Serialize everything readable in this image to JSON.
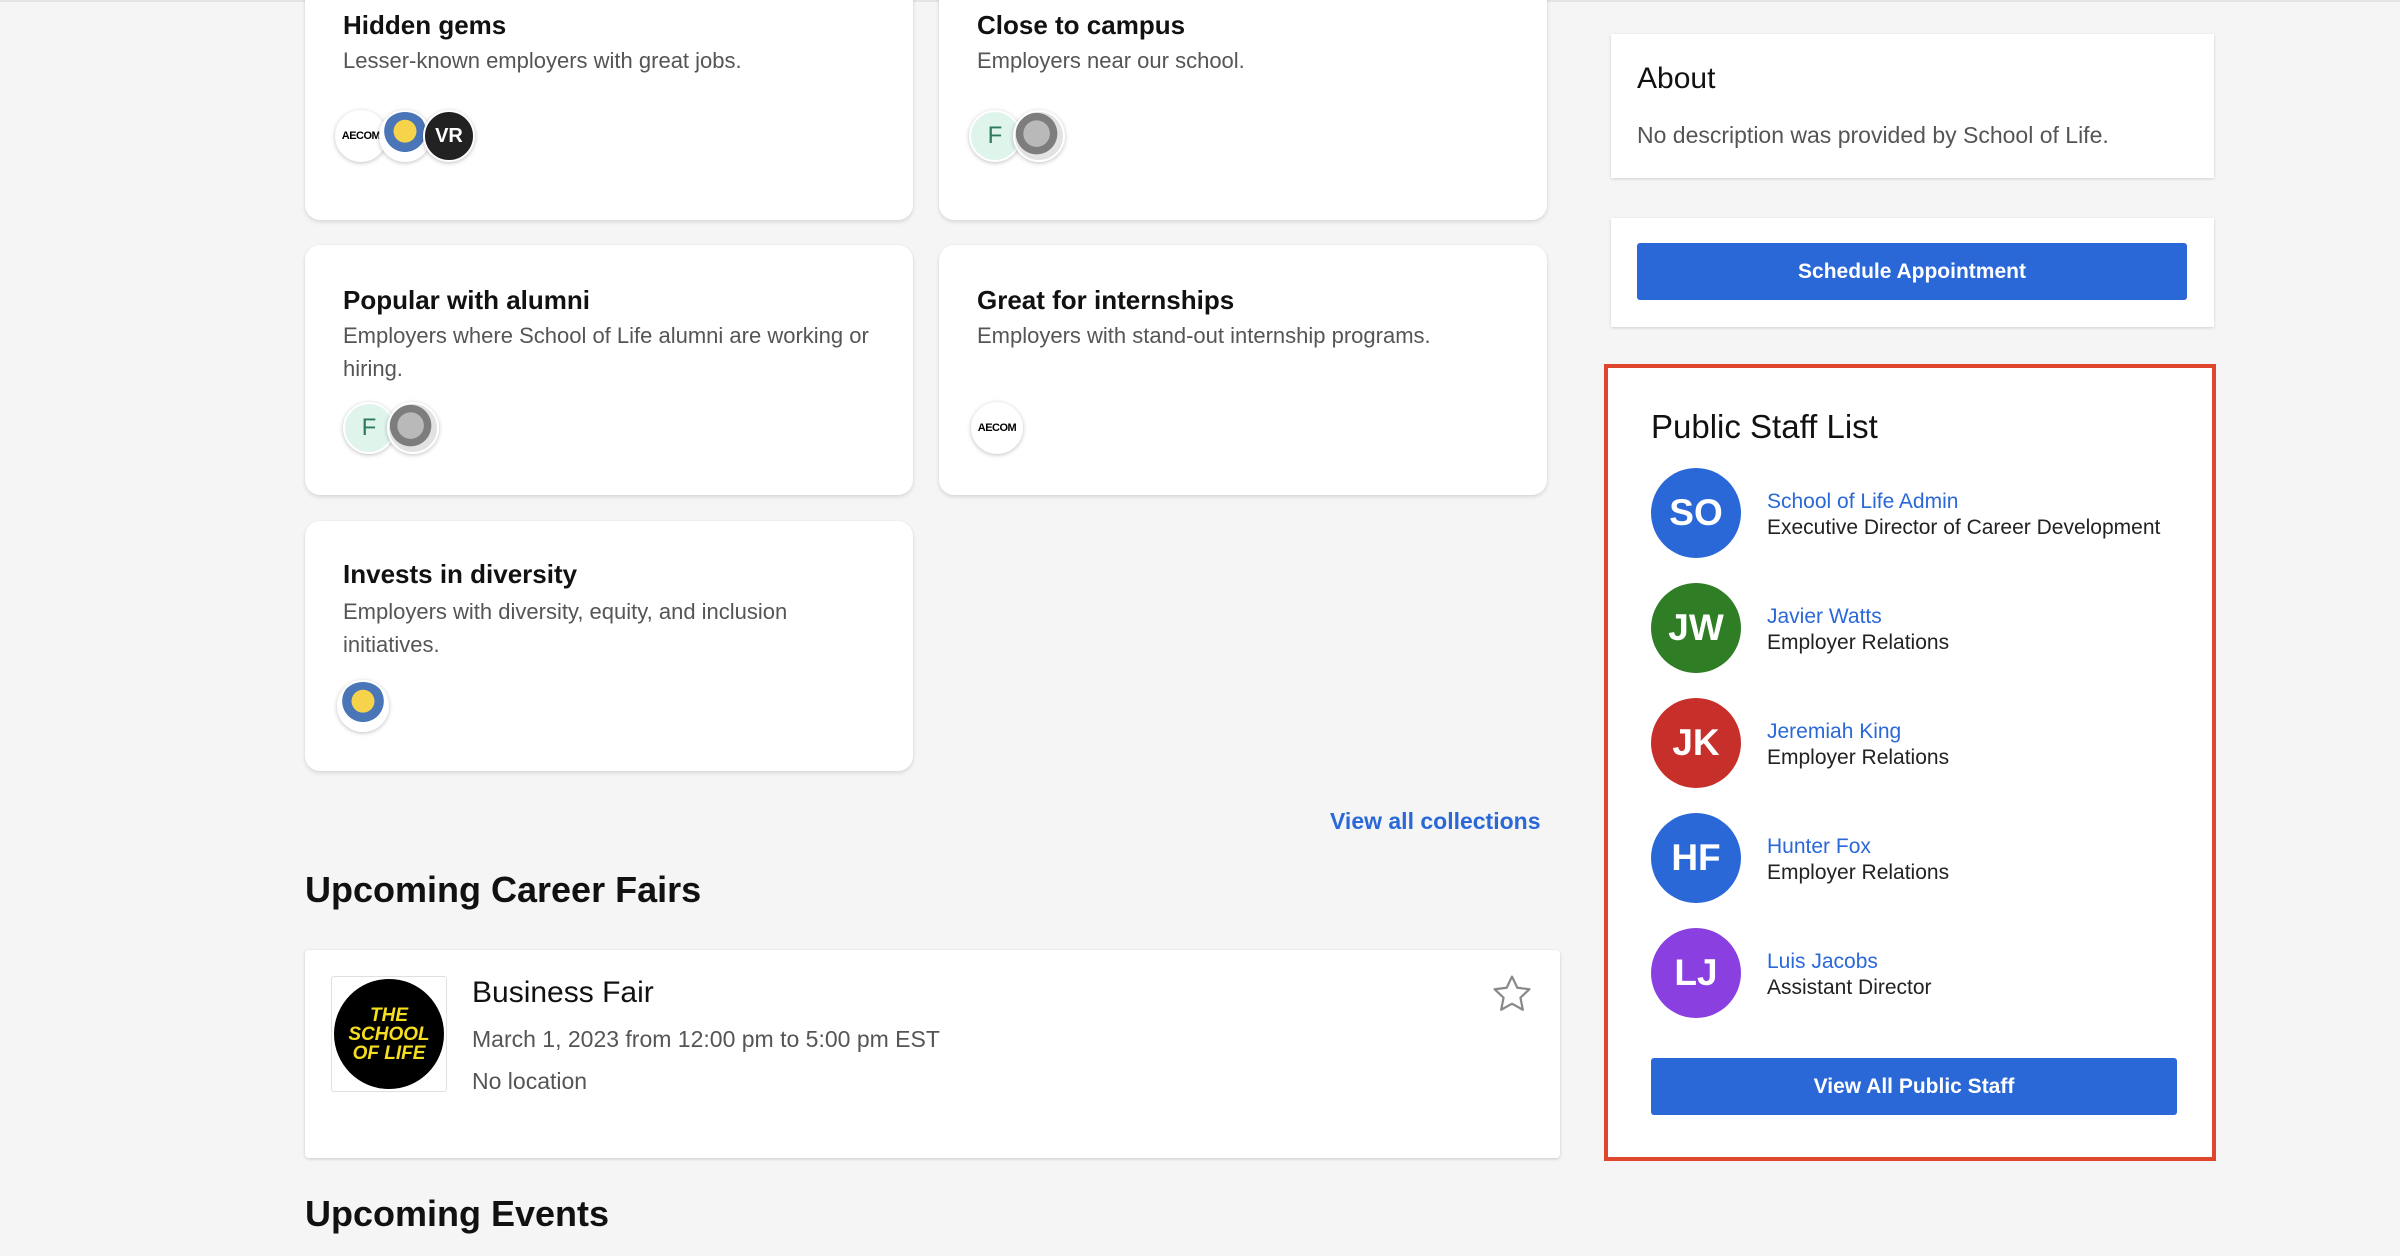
{
  "collections": [
    {
      "title": "Hidden gems",
      "desc": "Lesser-known employers with great jobs.",
      "logos": [
        "aecom-logo",
        "minion-logo",
        "vr-logo"
      ]
    },
    {
      "title": "Close to campus",
      "desc": "Employers near our school.",
      "logos": [
        "f-logo",
        "rhino-logo"
      ]
    },
    {
      "title": "Popular with alumni",
      "desc": "Employers where School of Life alumni are working or hiring.",
      "logos": [
        "f-logo",
        "rhino-logo"
      ]
    },
    {
      "title": "Great for internships",
      "desc": "Employers with stand-out internship programs.",
      "logos": [
        "aecom-logo"
      ]
    },
    {
      "title": "Invests in diversity",
      "desc": "Employers with diversity, equity, and inclusion initiatives.",
      "logos": [
        "minion-logo"
      ]
    }
  ],
  "logo_text": {
    "aecom": "AECOM",
    "vr": "VR",
    "f": "F"
  },
  "view_all_collections": "View all collections",
  "career_fairs": {
    "heading": "Upcoming Career Fairs",
    "fair": {
      "title": "Business Fair",
      "date": "March 1, 2023 from 12:00 pm to 5:00 pm EST",
      "location": "No location",
      "logo_lines": [
        "THE",
        "SCHOOL",
        "OF LIFE"
      ]
    }
  },
  "events_heading": "Upcoming Events",
  "about": {
    "title": "About",
    "description": "No description was provided by School of Life."
  },
  "schedule_button": "Schedule Appointment",
  "staff": {
    "title": "Public Staff List",
    "members": [
      {
        "initials": "SO",
        "name": "School of Life Admin",
        "role": "Executive Director of Career Development",
        "color": "#2a68d8"
      },
      {
        "initials": "JW",
        "name": "Javier Watts",
        "role": "Employer Relations",
        "color": "#2f7d24"
      },
      {
        "initials": "JK",
        "name": "Jeremiah King",
        "role": "Employer Relations",
        "color": "#c72f2a"
      },
      {
        "initials": "HF",
        "name": "Hunter Fox",
        "role": "Employer Relations",
        "color": "#2a68d8"
      },
      {
        "initials": "LJ",
        "name": "Luis Jacobs",
        "role": "Assistant Director",
        "color": "#8a3fe0"
      }
    ],
    "view_all_button": "View All Public Staff"
  },
  "colors": {
    "accent": "#2a68d8",
    "highlight_border": "#e0452d"
  }
}
